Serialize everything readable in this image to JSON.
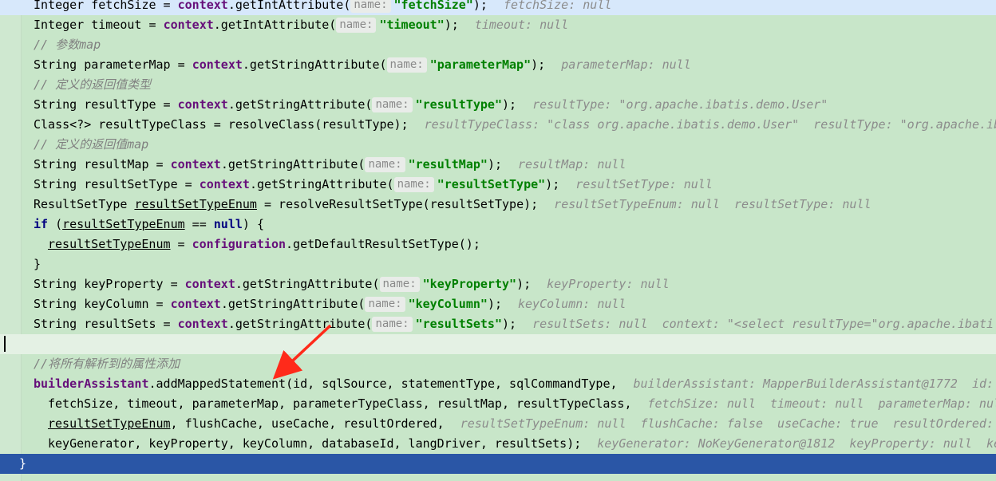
{
  "editor": {
    "lines": [
      {
        "style": "highlight",
        "indent": 1,
        "tokens": [
          {
            "t": "Integer fetchSize = "
          },
          {
            "t": "context",
            "c": "fld"
          },
          {
            "t": ".getIntAttribute("
          },
          {
            "hint": "name:"
          },
          {
            "t": "\"fetchSize\"",
            "c": "str"
          },
          {
            "t": ");"
          }
        ],
        "inline": "fetchSize: null"
      },
      {
        "style": "",
        "indent": 1,
        "tokens": [
          {
            "t": "Integer timeout = "
          },
          {
            "t": "context",
            "c": "fld"
          },
          {
            "t": ".getIntAttribute("
          },
          {
            "hint": "name:"
          },
          {
            "t": "\"timeout\"",
            "c": "str"
          },
          {
            "t": ");"
          }
        ],
        "inline": "timeout: null"
      },
      {
        "style": "",
        "indent": 1,
        "tokens": [
          {
            "t": "// 参数map",
            "c": "cmt"
          }
        ]
      },
      {
        "style": "",
        "indent": 1,
        "tokens": [
          {
            "t": "String parameterMap = "
          },
          {
            "t": "context",
            "c": "fld"
          },
          {
            "t": ".getStringAttribute("
          },
          {
            "hint": "name:"
          },
          {
            "t": "\"parameterMap\"",
            "c": "str"
          },
          {
            "t": ");"
          }
        ],
        "inline": "parameterMap: null"
      },
      {
        "style": "",
        "indent": 1,
        "tokens": [
          {
            "t": "// 定义的返回值类型",
            "c": "cmt"
          }
        ]
      },
      {
        "style": "",
        "indent": 1,
        "tokens": [
          {
            "t": "String resultType = "
          },
          {
            "t": "context",
            "c": "fld"
          },
          {
            "t": ".getStringAttribute("
          },
          {
            "hint": "name:"
          },
          {
            "t": "\"resultType\"",
            "c": "str"
          },
          {
            "t": ");"
          }
        ],
        "inline": "resultType: \"org.apache.ibatis.demo.User\""
      },
      {
        "style": "",
        "indent": 1,
        "tokens": [
          {
            "t": "Class<?> resultTypeClass = resolveClass(resultType);"
          }
        ],
        "inline": "resultTypeClass: \"class org.apache.ibatis.demo.User\"  resultType: \"org.apache.ib"
      },
      {
        "style": "",
        "indent": 1,
        "tokens": [
          {
            "t": "// 定义的返回值map",
            "c": "cmt"
          }
        ]
      },
      {
        "style": "",
        "indent": 1,
        "tokens": [
          {
            "t": "String resultMap = "
          },
          {
            "t": "context",
            "c": "fld"
          },
          {
            "t": ".getStringAttribute("
          },
          {
            "hint": "name:"
          },
          {
            "t": "\"resultMap\"",
            "c": "str"
          },
          {
            "t": ");"
          }
        ],
        "inline": "resultMap: null"
      },
      {
        "style": "",
        "indent": 1,
        "tokens": [
          {
            "t": "String resultSetType = "
          },
          {
            "t": "context",
            "c": "fld"
          },
          {
            "t": ".getStringAttribute("
          },
          {
            "hint": "name:"
          },
          {
            "t": "\"resultSetType\"",
            "c": "str"
          },
          {
            "t": ");"
          }
        ],
        "inline": "resultSetType: null"
      },
      {
        "style": "",
        "indent": 1,
        "tokens": [
          {
            "t": "ResultSetType "
          },
          {
            "t": "resultSetTypeEnum",
            "c": "ul"
          },
          {
            "t": " = resolveResultSetType(resultSetType);"
          }
        ],
        "inline": "resultSetTypeEnum: null  resultSetType: null"
      },
      {
        "style": "",
        "indent": 1,
        "tokens": [
          {
            "t": "if",
            "c": "kw"
          },
          {
            "t": " ("
          },
          {
            "t": "resultSetTypeEnum",
            "c": "ul"
          },
          {
            "t": " == "
          },
          {
            "t": "null",
            "c": "kw"
          },
          {
            "t": ") {"
          }
        ]
      },
      {
        "style": "",
        "indent": 2,
        "tokens": [
          {
            "t": "resultSetTypeEnum",
            "c": "ul"
          },
          {
            "t": " = "
          },
          {
            "t": "configuration",
            "c": "fld"
          },
          {
            "t": ".getDefaultResultSetType();"
          }
        ]
      },
      {
        "style": "",
        "indent": 1,
        "tokens": [
          {
            "t": "}"
          }
        ]
      },
      {
        "style": "",
        "indent": 1,
        "tokens": [
          {
            "t": "String keyProperty = "
          },
          {
            "t": "context",
            "c": "fld"
          },
          {
            "t": ".getStringAttribute("
          },
          {
            "hint": "name:"
          },
          {
            "t": "\"keyProperty\"",
            "c": "str"
          },
          {
            "t": ");"
          }
        ],
        "inline": "keyProperty: null"
      },
      {
        "style": "",
        "indent": 1,
        "tokens": [
          {
            "t": "String keyColumn = "
          },
          {
            "t": "context",
            "c": "fld"
          },
          {
            "t": ".getStringAttribute("
          },
          {
            "hint": "name:"
          },
          {
            "t": "\"keyColumn\"",
            "c": "str"
          },
          {
            "t": ");"
          }
        ],
        "inline": "keyColumn: null"
      },
      {
        "style": "",
        "indent": 1,
        "tokens": [
          {
            "t": "String resultSets = "
          },
          {
            "t": "context",
            "c": "fld"
          },
          {
            "t": ".getStringAttribute("
          },
          {
            "hint": "name:"
          },
          {
            "t": "\"resultSets\"",
            "c": "str"
          },
          {
            "t": ");"
          }
        ],
        "inline": "resultSets: null  context: \"<select resultType=\"org.apache.ibati"
      },
      {
        "style": "plain",
        "indent": 1,
        "tokens": []
      },
      {
        "style": "",
        "indent": 1,
        "tokens": [
          {
            "t": "//将所有解析到的属性添加",
            "c": "cmt"
          }
        ]
      },
      {
        "style": "",
        "indent": 1,
        "tokens": [
          {
            "t": "builderAssistant",
            "c": "fld"
          },
          {
            "t": ".addMappedStatement(id, sqlSource, statementType, sqlCommandType,"
          }
        ],
        "inline": "builderAssistant: MapperBuilderAssistant@1772  id: "
      },
      {
        "style": "",
        "indent": 2,
        "tokens": [
          {
            "t": "fetchSize, timeout, parameterMap, parameterTypeClass, resultMap, resultTypeClass,"
          }
        ],
        "inline": "fetchSize: null  timeout: null  parameterMap: nul"
      },
      {
        "style": "",
        "indent": 2,
        "tokens": [
          {
            "t": "resultSetTypeEnum",
            "c": "ul"
          },
          {
            "t": ", flushCache, useCache, resultOrdered,"
          }
        ],
        "inline": "resultSetTypeEnum: null  flushCache: false  useCache: true  resultOrdered: f"
      },
      {
        "style": "",
        "indent": 2,
        "tokens": [
          {
            "t": "keyGenerator, keyProperty, keyColumn, databaseId, langDriver, resultSets);"
          }
        ],
        "inline": "keyGenerator: NoKeyGenerator@1812  keyProperty: null  ke"
      },
      {
        "style": "selected",
        "indent": 0,
        "tokens": [
          {
            "t": "}"
          }
        ]
      }
    ]
  },
  "colors": {
    "background": "#c8e6c9",
    "selected_line": "#2a56a6",
    "arrow": "#ff2a1a"
  },
  "annotation": {
    "type": "red-arrow"
  }
}
